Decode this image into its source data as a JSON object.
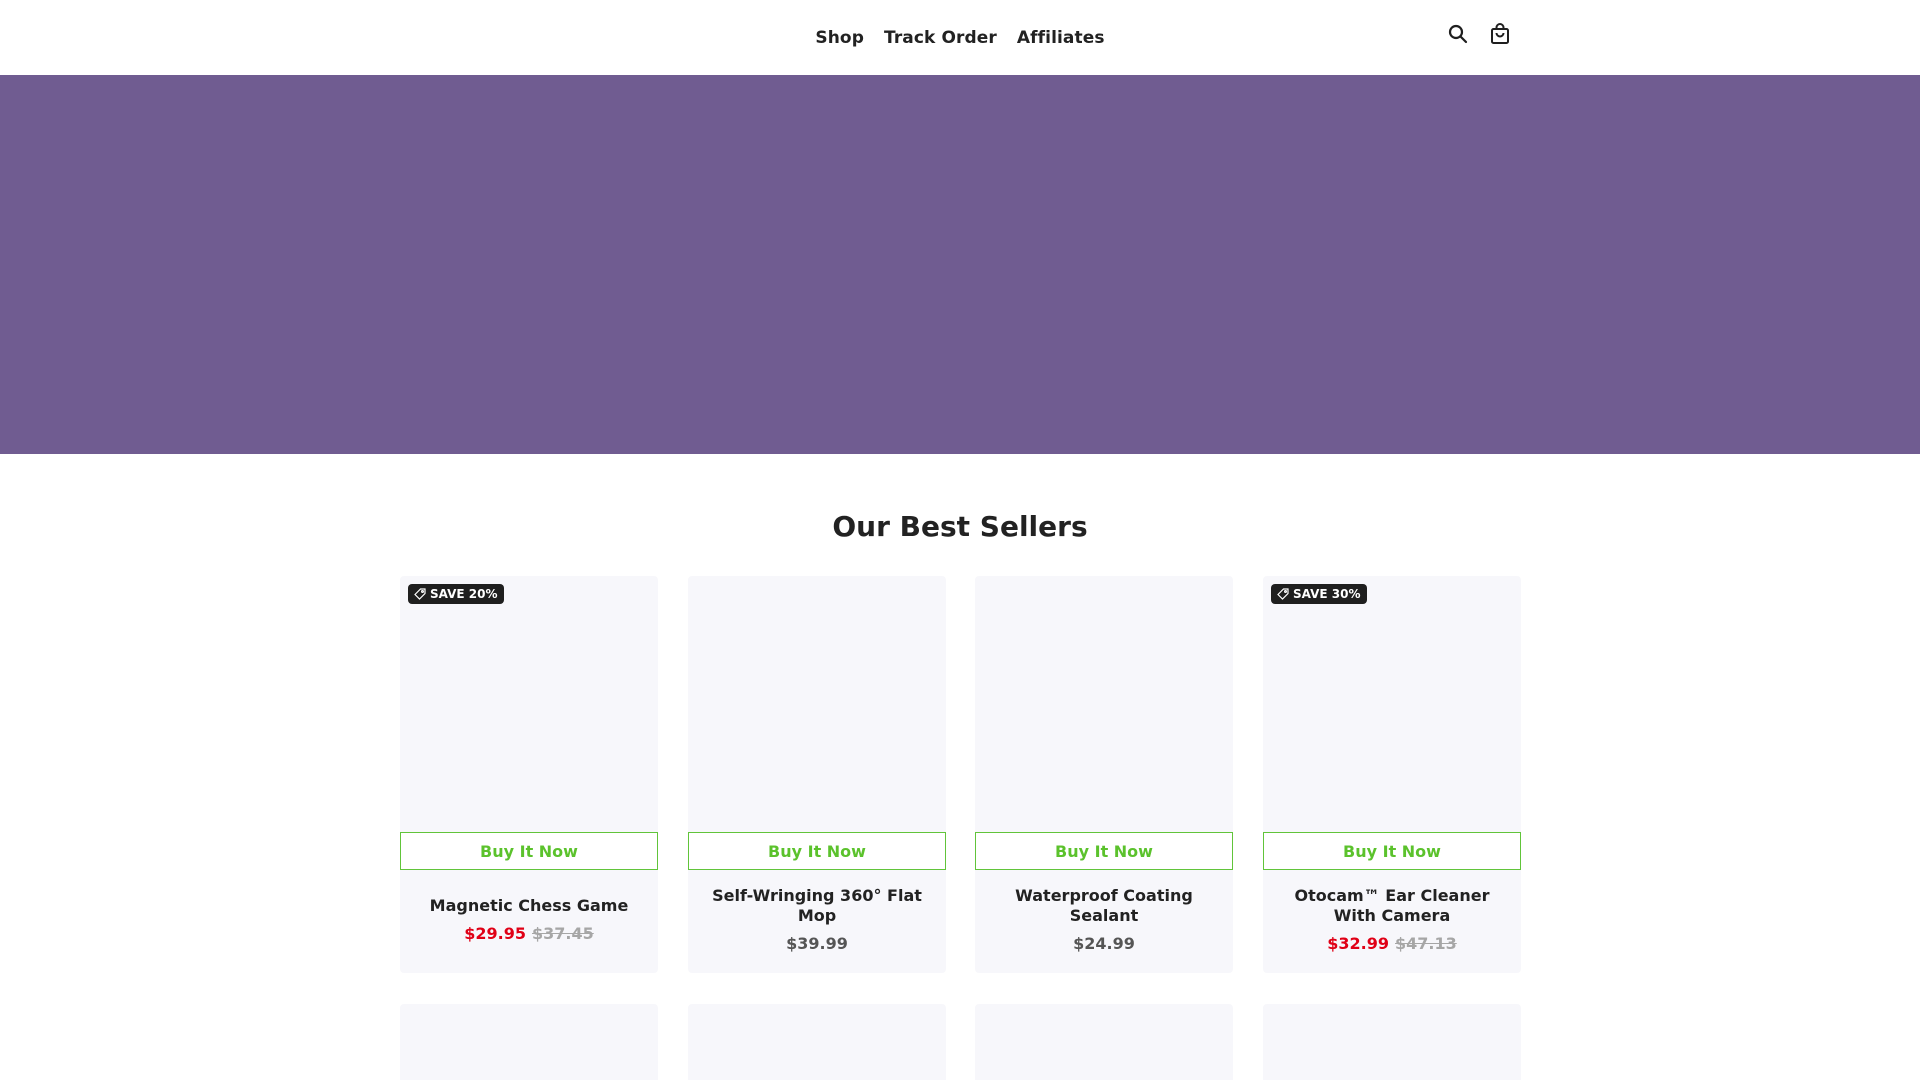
{
  "nav": {
    "items": [
      {
        "label": "Shop"
      },
      {
        "label": "Track Order"
      },
      {
        "label": "Affiliates"
      }
    ]
  },
  "header_icons": [
    "search-icon",
    "bag-icon"
  ],
  "hero": {
    "color": "#705c91"
  },
  "section": {
    "title": "Our Best Sellers"
  },
  "products": [
    {
      "badge": "SAVE 20%",
      "button": "Buy It Now",
      "title": "Magnetic Chess Game",
      "price": "$29.95",
      "compare_price": "$37.45",
      "on_sale": true
    },
    {
      "badge": "",
      "button": "Buy It Now",
      "title": "Self-Wringing 360° Flat Mop",
      "price": "$39.99",
      "compare_price": "",
      "on_sale": false
    },
    {
      "badge": "",
      "button": "Buy It Now",
      "title": "Waterproof Coating Sealant",
      "price": "$24.99",
      "compare_price": "",
      "on_sale": false
    },
    {
      "badge": "SAVE 30%",
      "button": "Buy It Now",
      "title": "Otocam™ Ear Cleaner With Camera",
      "price": "$32.99",
      "compare_price": "$47.13",
      "on_sale": true
    }
  ],
  "colors": {
    "accent_green": "#5bc22c",
    "sale_red": "#e00016",
    "badge_bg": "#1f1f1f"
  }
}
